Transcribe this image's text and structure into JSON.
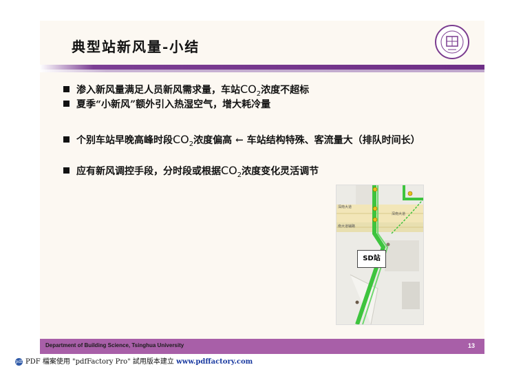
{
  "slide": {
    "title": "典型站新风量-小结",
    "bullets": [
      {
        "pre": "渗入新风量满足人员新风需求量，车站",
        "post": "浓度不超标"
      },
      {
        "pre": "夏季“小新风”额外引入热湿空气，增大耗冷量",
        "post": ""
      },
      {
        "pre": "个别车站早晚高峰时段",
        "post": "浓度偏高 ← 车站结构特殊、客流量大（排队时间长）"
      },
      {
        "pre": "应有新风调控手段，分时段或根据",
        "post": "浓度变化灵活调节"
      }
    ],
    "co2": {
      "base": "CO",
      "sub": "2"
    },
    "map": {
      "station_label": "SD站",
      "road_label_1": "深南大道",
      "road_label_2": "深南大道",
      "road_label_3": "南大道辅路"
    },
    "logo_icon": "tsinghua-seal-icon",
    "footer": {
      "text": "Department of Building Science, Tsinghua University",
      "page": "13"
    },
    "colors": {
      "accent": "#6e2f86",
      "footer": "#a85fa8",
      "map_green": "#3ec43e"
    }
  },
  "pdf_notice": {
    "text": "PDF 檔案使用 \"pdfFactory Pro\" 試用版本建立 ",
    "link": "www.pdffactory.com"
  }
}
